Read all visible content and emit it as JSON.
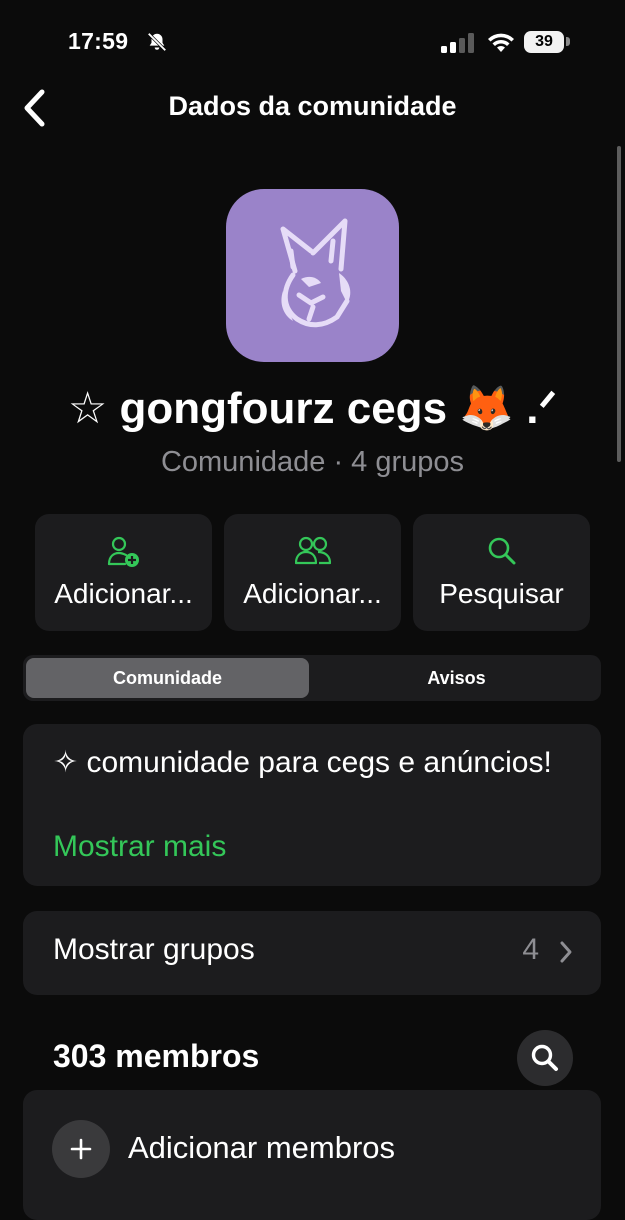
{
  "status_bar": {
    "time": "17:59",
    "battery": "39"
  },
  "nav": {
    "title": "Dados da comunidade"
  },
  "community": {
    "name": "☆ gongfourz cegs 🦊 .ᐟ",
    "subtitle": "Comunidade · 4 grupos",
    "avatar_color": "#9a83c9"
  },
  "actions": [
    {
      "label": "Adicionar...",
      "icon": "add-person-icon"
    },
    {
      "label": "Adicionar...",
      "icon": "group-icon"
    },
    {
      "label": "Pesquisar",
      "icon": "search-icon"
    }
  ],
  "tabs": [
    {
      "label": "Comunidade",
      "active": true
    },
    {
      "label": "Avisos",
      "active": false
    }
  ],
  "description": {
    "text": "✧ comunidade para cegs e anúncios!",
    "show_more": "Mostrar mais"
  },
  "groups": {
    "label": "Mostrar grupos",
    "count": "4"
  },
  "members": {
    "title": "303 membros",
    "add_label": "Adicionar membros"
  },
  "colors": {
    "accent": "#34c759",
    "background": "#0b0b0b",
    "card": "#1c1c1e"
  }
}
